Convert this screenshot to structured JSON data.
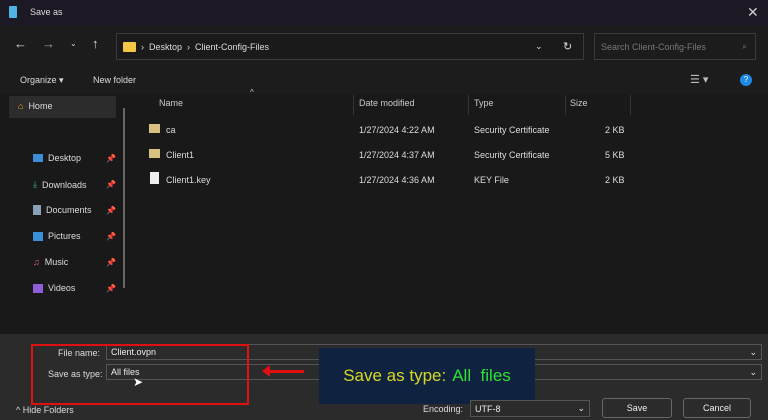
{
  "window": {
    "title": "Save as"
  },
  "nav": {
    "breadcrumb": [
      "Desktop",
      "Client-Config-Files"
    ],
    "search_placeholder": "Search Client-Config-Files"
  },
  "toolbar": {
    "organize": "Organize ▾",
    "new_folder": "New folder"
  },
  "sidebar": {
    "items": [
      {
        "label": "Home"
      },
      {
        "label": "Desktop"
      },
      {
        "label": "Downloads"
      },
      {
        "label": "Documents"
      },
      {
        "label": "Pictures"
      },
      {
        "label": "Music"
      },
      {
        "label": "Videos"
      }
    ]
  },
  "columns": [
    "Name",
    "Date modified",
    "Type",
    "Size"
  ],
  "files": [
    {
      "name": "ca",
      "date": "1/27/2024 4:22 AM",
      "type": "Security Certificate",
      "size": "2 KB"
    },
    {
      "name": "Client1",
      "date": "1/27/2024 4:37 AM",
      "type": "Security Certificate",
      "size": "5 KB"
    },
    {
      "name": "Client1.key",
      "date": "1/27/2024 4:36 AM",
      "type": "KEY File",
      "size": "2 KB"
    }
  ],
  "form": {
    "file_name_label": "File name:",
    "file_name": "Client.ovpn",
    "type_label": "Save as type:",
    "type": "All files",
    "encoding_label": "Encoding:",
    "encoding": "UTF-8",
    "save": "Save",
    "cancel": "Cancel",
    "hide_folders": "Hide Folders"
  },
  "annotation": {
    "prefix": "Save as type:",
    "highlight": "All  files"
  }
}
